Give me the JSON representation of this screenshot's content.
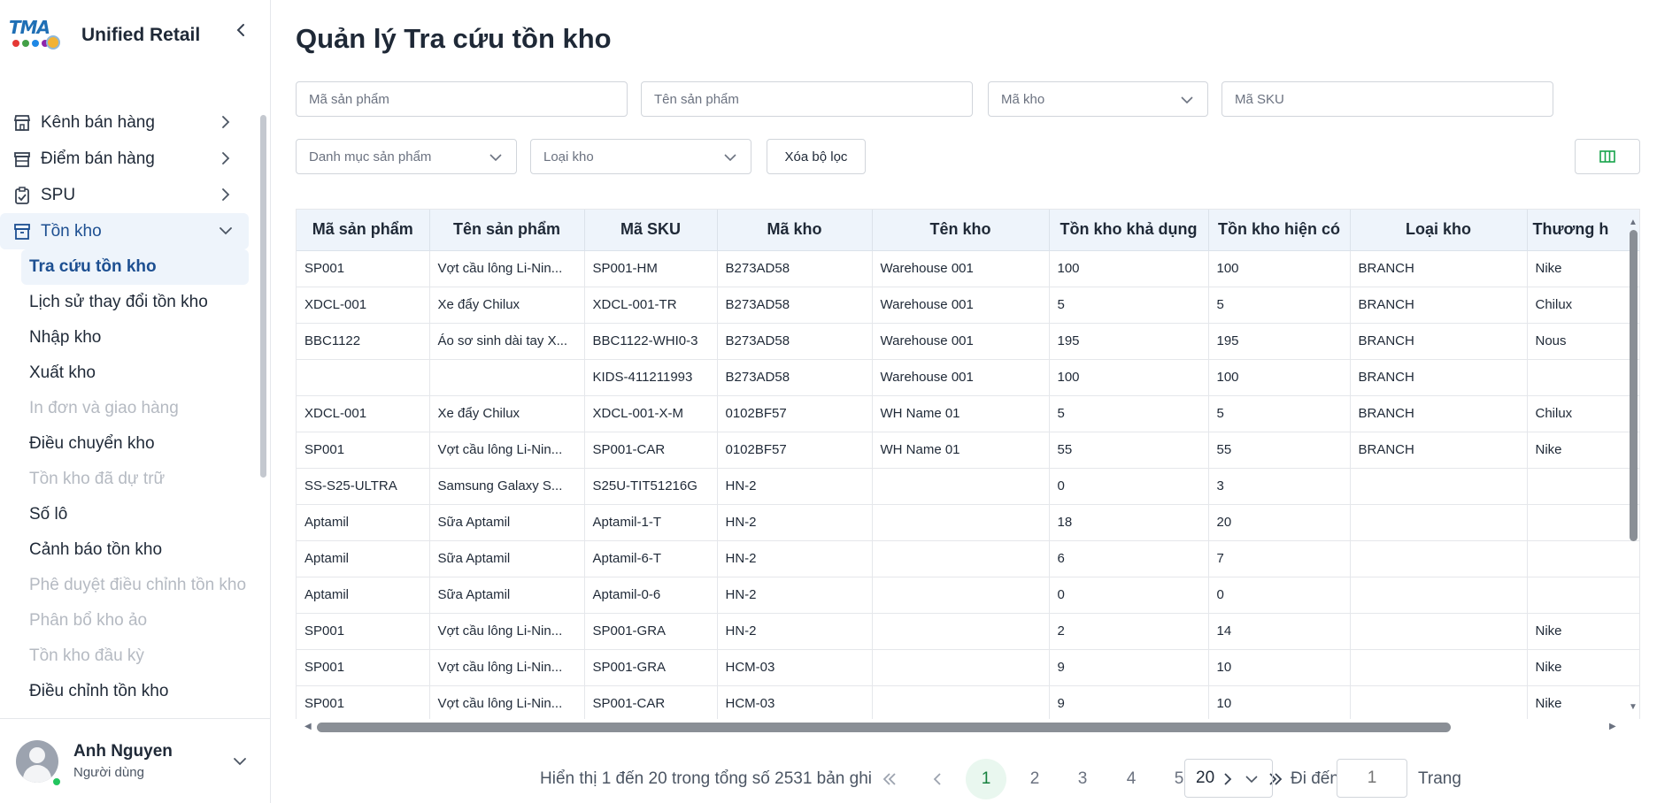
{
  "brand": {
    "logo_text": "TMA",
    "name": "Unified Retail",
    "dot_colors": [
      "#e53935",
      "#43a047",
      "#1e88e5",
      "#8e24aa"
    ]
  },
  "sidebar": {
    "menu": [
      {
        "label": "Kênh bán hàng",
        "icon": "store-icon"
      },
      {
        "label": "Điểm bán hàng",
        "icon": "shop-icon"
      },
      {
        "label": "SPU",
        "icon": "clipboard-check-icon"
      },
      {
        "label": "Tồn kho",
        "icon": "archive-icon",
        "expanded": true
      }
    ],
    "submenu": [
      {
        "label": "Tra cứu tồn kho",
        "state": "selected"
      },
      {
        "label": "Lịch sử thay đổi tồn kho",
        "state": "normal"
      },
      {
        "label": "Nhập kho",
        "state": "normal"
      },
      {
        "label": "Xuất kho",
        "state": "normal"
      },
      {
        "label": "In đơn và giao hàng",
        "state": "disabled"
      },
      {
        "label": "Điều chuyển kho",
        "state": "normal"
      },
      {
        "label": "Tồn kho đã dự trữ",
        "state": "disabled"
      },
      {
        "label": "Số lô",
        "state": "normal"
      },
      {
        "label": "Cảnh báo tồn kho",
        "state": "normal"
      },
      {
        "label": "Phê duyệt điều chỉnh tồn kho",
        "state": "disabled"
      },
      {
        "label": "Phân bổ kho ảo",
        "state": "disabled"
      },
      {
        "label": "Tồn kho đầu kỳ",
        "state": "disabled"
      },
      {
        "label": "Điều chỉnh tồn kho",
        "state": "normal"
      }
    ]
  },
  "user": {
    "name": "Anh Nguyen",
    "role": "Người dùng"
  },
  "page": {
    "title": "Quản lý Tra cứu tồn kho"
  },
  "filters": {
    "product_code_placeholder": "Mã sản phẩm",
    "product_name_placeholder": "Tên sản phẩm",
    "warehouse_code_placeholder": "Mã kho",
    "sku_placeholder": "Mã SKU",
    "category_placeholder": "Danh mục sản phẩm",
    "warehouse_type_placeholder": "Loại kho",
    "clear_label": "Xóa bộ lọc"
  },
  "table": {
    "columns": [
      "Mã sản phẩm",
      "Tên sản phẩm",
      "Mã SKU",
      "Mã kho",
      "Tên kho",
      "Tồn kho khả dụng",
      "Tồn kho hiện có",
      "Loại kho",
      "Thương h"
    ],
    "rows": [
      [
        "SP001",
        "Vợt cầu lông Li-Nin...",
        "SP001-HM",
        "B273AD58",
        "Warehouse 001",
        "100",
        "100",
        "BRANCH",
        "Nike"
      ],
      [
        "XDCL-001",
        "Xe đẩy Chilux",
        "XDCL-001-TR",
        "B273AD58",
        "Warehouse 001",
        "5",
        "5",
        "BRANCH",
        "Chilux"
      ],
      [
        "BBC1122",
        "Áo sơ sinh dài tay X...",
        "BBC1122-WHI0-3",
        "B273AD58",
        "Warehouse 001",
        "195",
        "195",
        "BRANCH",
        "Nous"
      ],
      [
        "",
        "",
        "KIDS-411211993",
        "B273AD58",
        "Warehouse 001",
        "100",
        "100",
        "BRANCH",
        ""
      ],
      [
        "XDCL-001",
        "Xe đẩy Chilux",
        "XDCL-001-X-M",
        "0102BF57",
        "WH Name 01",
        "5",
        "5",
        "BRANCH",
        "Chilux"
      ],
      [
        "SP001",
        "Vợt cầu lông Li-Nin...",
        "SP001-CAR",
        "0102BF57",
        "WH Name 01",
        "55",
        "55",
        "BRANCH",
        "Nike"
      ],
      [
        "SS-S25-ULTRA",
        "Samsung Galaxy S...",
        "S25U-TIT51216G",
        "HN-2",
        "",
        "0",
        "3",
        "",
        ""
      ],
      [
        "Aptamil",
        "Sữa Aptamil",
        "Aptamil-1-T",
        "HN-2",
        "",
        "18",
        "20",
        "",
        ""
      ],
      [
        "Aptamil",
        "Sữa Aptamil",
        "Aptamil-6-T",
        "HN-2",
        "",
        "6",
        "7",
        "",
        ""
      ],
      [
        "Aptamil",
        "Sữa Aptamil",
        "Aptamil-0-6",
        "HN-2",
        "",
        "0",
        "0",
        "",
        ""
      ],
      [
        "SP001",
        "Vợt cầu lông Li-Nin...",
        "SP001-GRA",
        "HN-2",
        "",
        "2",
        "14",
        "",
        "Nike"
      ],
      [
        "SP001",
        "Vợt cầu lông Li-Nin...",
        "SP001-GRA",
        "HCM-03",
        "",
        "9",
        "10",
        "",
        "Nike"
      ],
      [
        "SP001",
        "Vợt cầu lông Li-Nin...",
        "SP001-CAR",
        "HCM-03",
        "",
        "9",
        "10",
        "",
        "Nike"
      ]
    ]
  },
  "pagination": {
    "info": "Hiển thị 1 đến 20 trong tổng số 2531 bản ghi",
    "pages": [
      "1",
      "2",
      "3",
      "4",
      "5"
    ],
    "current": "1",
    "page_size": "20",
    "goto_label": "Đi đến",
    "goto_value": "1",
    "goto_suffix": "Trang"
  },
  "colors": {
    "accent": "#1d4f91",
    "active_bg": "#eef4fb",
    "header_bg": "#eef4fb",
    "current_page_bg": "#e9f7ef",
    "current_page_text": "#15803d",
    "column_toggle_icon": "#16a34a"
  }
}
